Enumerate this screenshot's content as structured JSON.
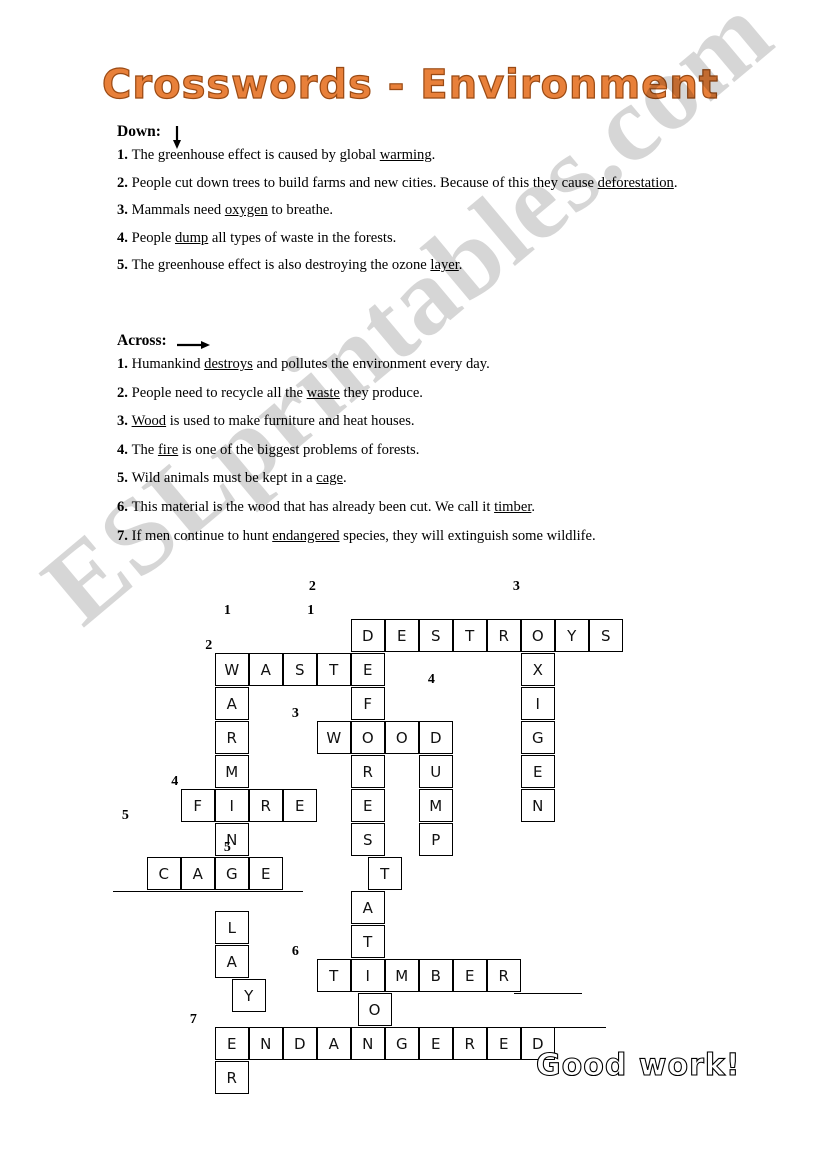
{
  "title": "Crosswords - Environment",
  "watermark": "ESLprintables.com",
  "footer": {
    "good_work": "Good  work!"
  },
  "down": {
    "heading": "Down:",
    "arrow_icon": "arrow-down-icon",
    "clues": [
      {
        "num": "1.",
        "before": "The greenhouse effect is caused by global ",
        "answer": "warming",
        "after": "."
      },
      {
        "num": "2.",
        "before": "People cut down trees to build farms and new cities. Because of this they cause ",
        "answer": "deforestation",
        "after": "."
      },
      {
        "num": "3.",
        "before": "Mammals need ",
        "answer": "oxygen",
        "after": " to breathe."
      },
      {
        "num": "4.",
        "before": "People ",
        "answer": "dump",
        "after": " all types of waste in the forests."
      },
      {
        "num": "5.",
        "before": "The greenhouse effect is also destroying the ozone ",
        "answer": "layer",
        "after": "."
      }
    ]
  },
  "across": {
    "heading": "Across:",
    "arrow_icon": "arrow-right-icon",
    "clues": [
      {
        "num": "1.",
        "before": "Humankind ",
        "answer": "destroys",
        "after": " and pollutes the environment every day."
      },
      {
        "num": "2.",
        "before": "People need to recycle all the ",
        "answer": "waste",
        "after": " they produce."
      },
      {
        "num": "3.",
        "before": "",
        "answer": "Wood",
        "after": " is used to make furniture and heat houses."
      },
      {
        "num": "4.",
        "before": "The ",
        "answer": "fire",
        "after": " is one of the biggest problems of forests."
      },
      {
        "num": "5.",
        "before": "Wild animals must be kept in a ",
        "answer": "cage",
        "after": "."
      },
      {
        "num": "6.",
        "before": "This material is the wood that has already been cut. We call it ",
        "answer": "timber",
        "after": "."
      },
      {
        "num": "7.",
        "before": "If men continue to hunt ",
        "answer": "endangered",
        "after": " species, they will extinguish some wildlife."
      }
    ]
  },
  "grid": {
    "cell_size": 34,
    "labels": [
      {
        "text": "1",
        "col": 3.1,
        "row": -0.7
      },
      {
        "text": "2",
        "col": 5.6,
        "row": -1.4
      },
      {
        "text": "3",
        "col": 11.6,
        "row": -1.4
      },
      {
        "text": "1",
        "col": 5.55,
        "row": -0.7
      },
      {
        "text": "2",
        "col": 2.55,
        "row": 0.32
      },
      {
        "text": "4",
        "col": 9.1,
        "row": 1.32
      },
      {
        "text": "3",
        "col": 5.1,
        "row": 2.32
      },
      {
        "text": "4",
        "col": 1.55,
        "row": 4.32
      },
      {
        "text": "5",
        "col": 0.1,
        "row": 5.32
      },
      {
        "text": "5",
        "col": 3.1,
        "row": 6.25
      },
      {
        "text": "6",
        "col": 5.1,
        "row": 9.32
      },
      {
        "text": "7",
        "col": 2.1,
        "row": 11.32
      }
    ],
    "cells": [
      {
        "letter": "D",
        "col": 7,
        "row": 0
      },
      {
        "letter": "E",
        "col": 8,
        "row": 0
      },
      {
        "letter": "S",
        "col": 9,
        "row": 0
      },
      {
        "letter": "T",
        "col": 10,
        "row": 0
      },
      {
        "letter": "R",
        "col": 11,
        "row": 0
      },
      {
        "letter": "O",
        "col": 12,
        "row": 0
      },
      {
        "letter": "Y",
        "col": 13,
        "row": 0
      },
      {
        "letter": "S",
        "col": 14,
        "row": 0
      },
      {
        "letter": "W",
        "col": 3,
        "row": 1
      },
      {
        "letter": "A",
        "col": 4,
        "row": 1
      },
      {
        "letter": "S",
        "col": 5,
        "row": 1
      },
      {
        "letter": "T",
        "col": 6,
        "row": 1
      },
      {
        "letter": "E",
        "col": 7,
        "row": 1
      },
      {
        "letter": "X",
        "col": 12,
        "row": 1
      },
      {
        "letter": "A",
        "col": 3,
        "row": 2
      },
      {
        "letter": "F",
        "col": 7,
        "row": 2
      },
      {
        "letter": "I",
        "col": 12,
        "row": 2
      },
      {
        "letter": "R",
        "col": 3,
        "row": 3
      },
      {
        "letter": "W",
        "col": 6,
        "row": 3
      },
      {
        "letter": "O",
        "col": 7,
        "row": 3
      },
      {
        "letter": "O",
        "col": 8,
        "row": 3
      },
      {
        "letter": "D",
        "col": 9,
        "row": 3
      },
      {
        "letter": "G",
        "col": 12,
        "row": 3
      },
      {
        "letter": "M",
        "col": 3,
        "row": 4
      },
      {
        "letter": "R",
        "col": 7,
        "row": 4
      },
      {
        "letter": "U",
        "col": 9,
        "row": 4
      },
      {
        "letter": "E",
        "col": 12,
        "row": 4
      },
      {
        "letter": "F",
        "col": 2,
        "row": 5
      },
      {
        "letter": "I",
        "col": 3,
        "row": 5
      },
      {
        "letter": "R",
        "col": 4,
        "row": 5
      },
      {
        "letter": "E",
        "col": 5,
        "row": 5
      },
      {
        "letter": "E",
        "col": 7,
        "row": 5
      },
      {
        "letter": "M",
        "col": 9,
        "row": 5
      },
      {
        "letter": "N",
        "col": 12,
        "row": 5
      },
      {
        "letter": "N",
        "col": 3,
        "row": 6
      },
      {
        "letter": "S",
        "col": 7,
        "row": 6
      },
      {
        "letter": "P",
        "col": 9,
        "row": 6
      },
      {
        "letter": "C",
        "col": 1,
        "row": 7
      },
      {
        "letter": "A",
        "col": 2,
        "row": 7
      },
      {
        "letter": "G",
        "col": 3,
        "row": 7
      },
      {
        "letter": "E",
        "col": 4,
        "row": 7
      },
      {
        "letter": "T",
        "col": 7.5,
        "row": 7
      },
      {
        "letter": "L",
        "col": 3,
        "row": 8.6
      },
      {
        "letter": "A",
        "col": 7,
        "row": 8
      },
      {
        "letter": "A",
        "col": 3,
        "row": 9.6
      },
      {
        "letter": "T",
        "col": 7,
        "row": 9
      },
      {
        "letter": "T",
        "col": 6,
        "row": 10
      },
      {
        "letter": "I",
        "col": 7,
        "row": 10
      },
      {
        "letter": "M",
        "col": 8,
        "row": 10
      },
      {
        "letter": "B",
        "col": 9,
        "row": 10
      },
      {
        "letter": "E",
        "col": 10,
        "row": 10
      },
      {
        "letter": "R",
        "col": 11,
        "row": 10
      },
      {
        "letter": "Y",
        "col": 3.5,
        "row": 10.6
      },
      {
        "letter": "O",
        "col": 7.2,
        "row": 11
      },
      {
        "letter": "E",
        "col": 3,
        "row": 12
      },
      {
        "letter": "N",
        "col": 4,
        "row": 12
      },
      {
        "letter": "D",
        "col": 5,
        "row": 12
      },
      {
        "letter": "A",
        "col": 6,
        "row": 12
      },
      {
        "letter": "N",
        "col": 7,
        "row": 12
      },
      {
        "letter": "G",
        "col": 8,
        "row": 12
      },
      {
        "letter": "E",
        "col": 9,
        "row": 12
      },
      {
        "letter": "R",
        "col": 10,
        "row": 12
      },
      {
        "letter": "E",
        "col": 11,
        "row": 12
      },
      {
        "letter": "D",
        "col": 12,
        "row": 12
      },
      {
        "letter": "R",
        "col": 3,
        "row": 13
      }
    ],
    "rules": [
      {
        "col": 0,
        "row": 8,
        "len": 5.6
      },
      {
        "col": 11.8,
        "row": 11,
        "len": 2.0
      },
      {
        "col": 12.5,
        "row": 12,
        "len": 2.0
      }
    ]
  }
}
